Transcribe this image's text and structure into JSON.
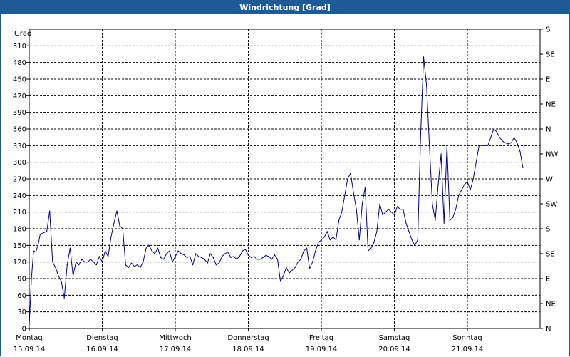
{
  "window": {
    "title": "Windrichtung [Grad]"
  },
  "chart_data": {
    "type": "line",
    "title": "Windrichtung [Grad]",
    "ylabel": "Grad",
    "ylim": [
      0,
      540
    ],
    "y_ticks": [
      0,
      30,
      60,
      90,
      120,
      150,
      180,
      210,
      240,
      270,
      300,
      330,
      360,
      390,
      420,
      450,
      480,
      510
    ],
    "right_axis_labels": [
      "N",
      "NE",
      "E",
      "SE",
      "S",
      "SW",
      "W",
      "NW",
      "N",
      "NE",
      "E",
      "SE",
      "S"
    ],
    "x_days": [
      {
        "day": "Montag",
        "date": "15.09.14"
      },
      {
        "day": "Dienstag",
        "date": "16.09.14"
      },
      {
        "day": "Mittwoch",
        "date": "17.09.14"
      },
      {
        "day": "Donnerstag",
        "date": "18.09.14"
      },
      {
        "day": "Freitag",
        "date": "19.09.14"
      },
      {
        "day": "Samstag",
        "date": "20.09.14"
      },
      {
        "day": "Sonntag",
        "date": "21.09.14"
      }
    ],
    "xlim": [
      0,
      7.1
    ],
    "grid": true,
    "series": [
      {
        "color": "#00008b",
        "points": [
          [
            0.0,
            5
          ],
          [
            0.03,
            90
          ],
          [
            0.06,
            140
          ],
          [
            0.09,
            138
          ],
          [
            0.12,
            150
          ],
          [
            0.15,
            170
          ],
          [
            0.2,
            173
          ],
          [
            0.24,
            175
          ],
          [
            0.28,
            212
          ],
          [
            0.32,
            120
          ],
          [
            0.36,
            110
          ],
          [
            0.4,
            95
          ],
          [
            0.44,
            85
          ],
          [
            0.48,
            55
          ],
          [
            0.52,
            115
          ],
          [
            0.56,
            145
          ],
          [
            0.6,
            95
          ],
          [
            0.64,
            120
          ],
          [
            0.68,
            115
          ],
          [
            0.72,
            125
          ],
          [
            0.76,
            120
          ],
          [
            0.8,
            120
          ],
          [
            0.84,
            125
          ],
          [
            0.88,
            120
          ],
          [
            0.92,
            115
          ],
          [
            0.96,
            130
          ],
          [
            1.0,
            120
          ],
          [
            1.04,
            140
          ],
          [
            1.08,
            130
          ],
          [
            1.12,
            165
          ],
          [
            1.16,
            190
          ],
          [
            1.2,
            212
          ],
          [
            1.24,
            185
          ],
          [
            1.28,
            180
          ],
          [
            1.32,
            115
          ],
          [
            1.36,
            110
          ],
          [
            1.4,
            118
          ],
          [
            1.44,
            112
          ],
          [
            1.48,
            115
          ],
          [
            1.52,
            110
          ],
          [
            1.56,
            120
          ],
          [
            1.6,
            145
          ],
          [
            1.64,
            150
          ],
          [
            1.68,
            140
          ],
          [
            1.72,
            135
          ],
          [
            1.76,
            145
          ],
          [
            1.8,
            128
          ],
          [
            1.84,
            125
          ],
          [
            1.88,
            135
          ],
          [
            1.92,
            140
          ],
          [
            1.96,
            120
          ],
          [
            2.0,
            130
          ],
          [
            2.04,
            140
          ],
          [
            2.08,
            135
          ],
          [
            2.12,
            133
          ],
          [
            2.16,
            128
          ],
          [
            2.2,
            130
          ],
          [
            2.24,
            115
          ],
          [
            2.28,
            135
          ],
          [
            2.32,
            130
          ],
          [
            2.36,
            128
          ],
          [
            2.4,
            125
          ],
          [
            2.44,
            118
          ],
          [
            2.48,
            135
          ],
          [
            2.52,
            128
          ],
          [
            2.56,
            115
          ],
          [
            2.6,
            118
          ],
          [
            2.64,
            130
          ],
          [
            2.68,
            135
          ],
          [
            2.72,
            138
          ],
          [
            2.76,
            128
          ],
          [
            2.8,
            130
          ],
          [
            2.84,
            125
          ],
          [
            2.88,
            130
          ],
          [
            2.92,
            140
          ],
          [
            2.96,
            143
          ],
          [
            3.0,
            132
          ],
          [
            3.04,
            128
          ],
          [
            3.08,
            130
          ],
          [
            3.12,
            125
          ],
          [
            3.16,
            125
          ],
          [
            3.2,
            128
          ],
          [
            3.24,
            132
          ],
          [
            3.28,
            130
          ],
          [
            3.32,
            125
          ],
          [
            3.36,
            133
          ],
          [
            3.4,
            125
          ],
          [
            3.44,
            85
          ],
          [
            3.48,
            95
          ],
          [
            3.52,
            110
          ],
          [
            3.56,
            100
          ],
          [
            3.6,
            105
          ],
          [
            3.64,
            110
          ],
          [
            3.68,
            120
          ],
          [
            3.72,
            125
          ],
          [
            3.76,
            140
          ],
          [
            3.8,
            145
          ],
          [
            3.84,
            108
          ],
          [
            3.88,
            120
          ],
          [
            3.92,
            140
          ],
          [
            3.96,
            155
          ],
          [
            4.0,
            160
          ],
          [
            4.04,
            165
          ],
          [
            4.08,
            175
          ],
          [
            4.12,
            160
          ],
          [
            4.16,
            165
          ],
          [
            4.2,
            160
          ],
          [
            4.24,
            195
          ],
          [
            4.28,
            210
          ],
          [
            4.32,
            240
          ],
          [
            4.36,
            270
          ],
          [
            4.4,
            280
          ],
          [
            4.44,
            245
          ],
          [
            4.48,
            215
          ],
          [
            4.52,
            160
          ],
          [
            4.56,
            225
          ],
          [
            4.6,
            255
          ],
          [
            4.64,
            140
          ],
          [
            4.68,
            145
          ],
          [
            4.72,
            155
          ],
          [
            4.76,
            175
          ],
          [
            4.8,
            225
          ],
          [
            4.84,
            205
          ],
          [
            4.88,
            210
          ],
          [
            4.92,
            215
          ],
          [
            4.96,
            210
          ],
          [
            5.0,
            205
          ],
          [
            5.04,
            220
          ],
          [
            5.08,
            215
          ],
          [
            5.12,
            215
          ],
          [
            5.16,
            190
          ],
          [
            5.2,
            175
          ],
          [
            5.24,
            160
          ],
          [
            5.28,
            150
          ],
          [
            5.32,
            160
          ],
          [
            5.36,
            350
          ],
          [
            5.4,
            490
          ],
          [
            5.44,
            440
          ],
          [
            5.48,
            330
          ],
          [
            5.52,
            225
          ],
          [
            5.56,
            195
          ],
          [
            5.6,
            260
          ],
          [
            5.64,
            315
          ],
          [
            5.68,
            190
          ],
          [
            5.72,
            330
          ],
          [
            5.76,
            195
          ],
          [
            5.8,
            200
          ],
          [
            5.84,
            215
          ],
          [
            5.88,
            240
          ],
          [
            5.92,
            250
          ],
          [
            5.96,
            260
          ],
          [
            6.0,
            265
          ],
          [
            6.04,
            250
          ],
          [
            6.08,
            270
          ],
          [
            6.12,
            300
          ],
          [
            6.16,
            330
          ],
          [
            6.2,
            330
          ],
          [
            6.24,
            330
          ],
          [
            6.28,
            330
          ],
          [
            6.32,
            345
          ],
          [
            6.36,
            360
          ],
          [
            6.4,
            355
          ],
          [
            6.44,
            345
          ],
          [
            6.48,
            338
          ],
          [
            6.52,
            335
          ],
          [
            6.56,
            333
          ],
          [
            6.6,
            335
          ],
          [
            6.64,
            345
          ],
          [
            6.68,
            335
          ],
          [
            6.72,
            320
          ],
          [
            6.76,
            290
          ]
        ]
      }
    ]
  }
}
